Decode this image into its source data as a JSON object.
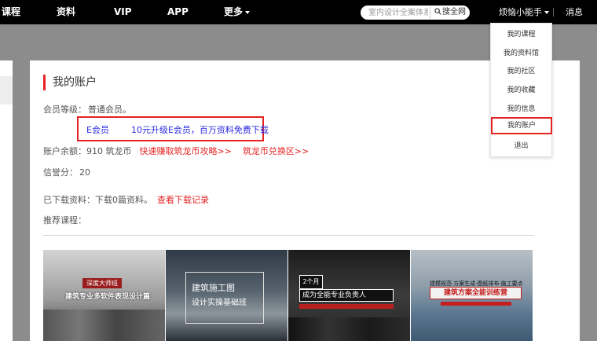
{
  "nav": {
    "items": [
      "课程",
      "资料",
      "VIP",
      "APP",
      "更多"
    ],
    "search_placeholder": "室内设计全案体系",
    "search_button": "搜全网",
    "username": "烦恼小能手",
    "messages": "消息"
  },
  "dropdown": {
    "items": [
      "我的课程",
      "我的资料馆",
      "我的社区",
      "我的收藏",
      "我的信息",
      "我的账户",
      "退出"
    ],
    "active_item": "我的账户"
  },
  "account": {
    "title": "我的账户",
    "level_label": "会员等级：",
    "level_value": "普通会员。",
    "promo_member": "E会员",
    "promo_text": "10元升级E会员，百万资料免费下载",
    "balance_label": "账户余额：",
    "balance_value": "910 筑龙币",
    "earn_link": "快速赚取筑龙币攻略>>",
    "exchange_link": "筑龙币兑换区>>",
    "credit_label": "信誉分：",
    "credit_value": "20",
    "downloaded_label": "已下载资料：",
    "downloaded_value": "下载0篇资料。",
    "download_record_link": "查看下载记录",
    "recommend_label": "推荐课程："
  },
  "courses": [
    {
      "banner": "深度大师班",
      "title": "建筑专业多软件表现设计篇"
    },
    {
      "title": "建筑施工图",
      "subtitle": "设计实操基础班"
    },
    {
      "tag": "2个月",
      "title": "成为全能专业负责人"
    },
    {
      "top": "建模规范·方案生成·图纸排布·施工要点",
      "title": "建筑方案全能训练营"
    }
  ],
  "colors": {
    "accent_red": "#e62222",
    "link_blue": "#2a2ae0",
    "nav_bg": "#000000"
  }
}
